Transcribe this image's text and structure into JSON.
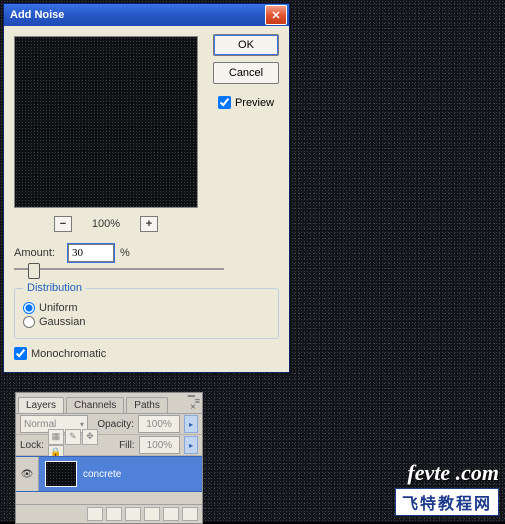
{
  "dialog": {
    "title": "Add Noise",
    "ok": "OK",
    "cancel": "Cancel",
    "preview_label": "Preview",
    "preview_checked": true,
    "zoom_out": "−",
    "zoom_in": "+",
    "zoom_value": "100%",
    "amount_label": "Amount:",
    "amount_value": "30",
    "amount_unit": "%",
    "distribution": {
      "legend": "Distribution",
      "uniform": "Uniform",
      "gaussian": "Gaussian",
      "selected": "uniform"
    },
    "mono_label": "Monochromatic",
    "mono_checked": true
  },
  "layers_panel": {
    "tabs": [
      "Layers",
      "Channels",
      "Paths"
    ],
    "active_tab": 0,
    "blend_mode": "Normal",
    "opacity_label": "Opacity:",
    "opacity_value": "100%",
    "lock_label": "Lock:",
    "fill_label": "Fill:",
    "fill_value": "100%",
    "layer_name": "concrete"
  },
  "watermark": {
    "line1a": "fevte",
    "line1b": ".com",
    "line2": "飞特教程网"
  },
  "icons": {
    "close": "✕",
    "eye": "👁",
    "chev": "▾",
    "right": "▸"
  }
}
